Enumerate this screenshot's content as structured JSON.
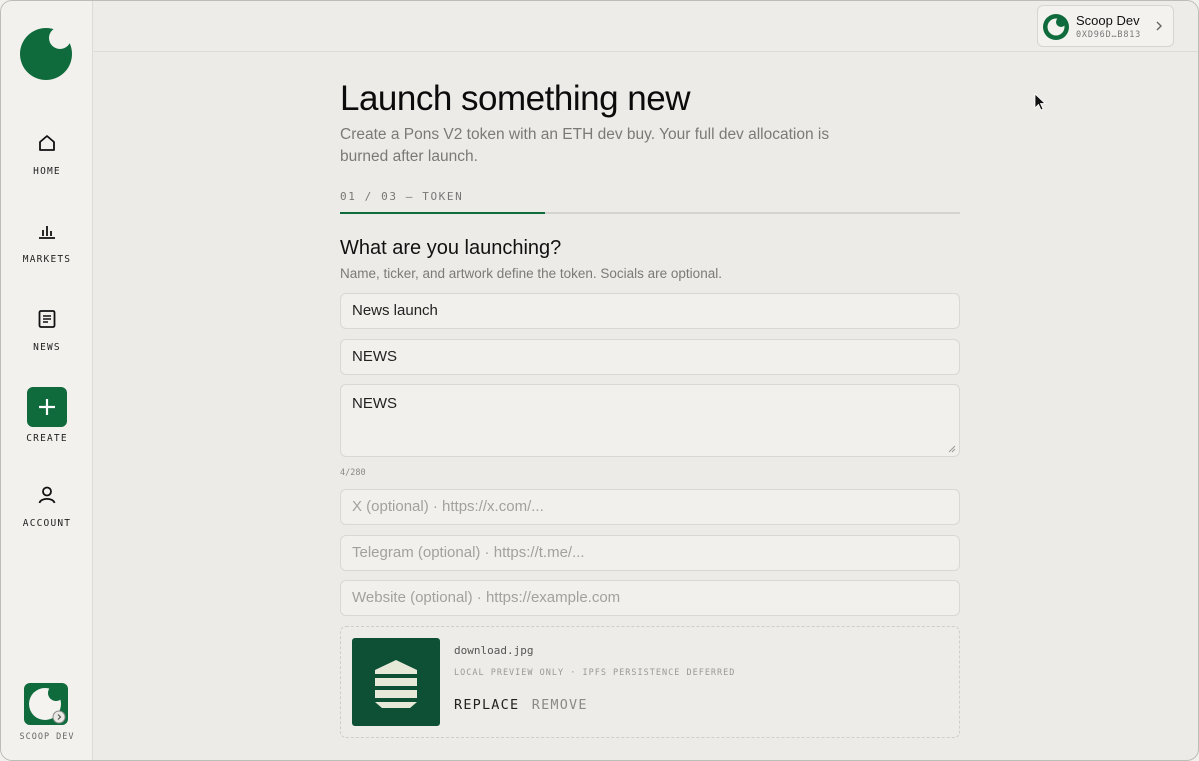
{
  "sidebar": {
    "items": [
      {
        "label": "HOME",
        "icon": "home-icon"
      },
      {
        "label": "MARKETS",
        "icon": "bar-chart-icon"
      },
      {
        "label": "NEWS",
        "icon": "document-icon"
      },
      {
        "label": "CREATE",
        "icon": "plus-icon"
      },
      {
        "label": "ACCOUNT",
        "icon": "user-icon"
      }
    ],
    "profile_label": "SCOOP DEV"
  },
  "wallet": {
    "name": "Scoop Dev",
    "address": "0XD96D…B813"
  },
  "page": {
    "title": "Launch something new",
    "subtitle": "Create a Pons V2 token with an ETH dev buy. Your full dev allocation is burned after launch.",
    "step": "01 / 03 — TOKEN",
    "step_progress": 0.33
  },
  "section": {
    "title": "What are you launching?",
    "subtitle": "Name, ticker, and artwork define the token. Socials are optional."
  },
  "form": {
    "name_value": "News launch",
    "ticker_value": "NEWS",
    "description_value": "NEWS",
    "description_counter": "4/280",
    "x_placeholder": "X (optional) · https://x.com/...",
    "telegram_placeholder": "Telegram (optional) · https://t.me/...",
    "website_placeholder": "Website (optional) · https://example.com"
  },
  "upload": {
    "file_name": "download.jpg",
    "note": "LOCAL PREVIEW ONLY · IPFS PERSISTENCE DEFERRED",
    "replace_label": "REPLACE",
    "remove_label": "REMOVE"
  },
  "colors": {
    "brand": "#0f6a3c",
    "background": "#ecebe7"
  }
}
